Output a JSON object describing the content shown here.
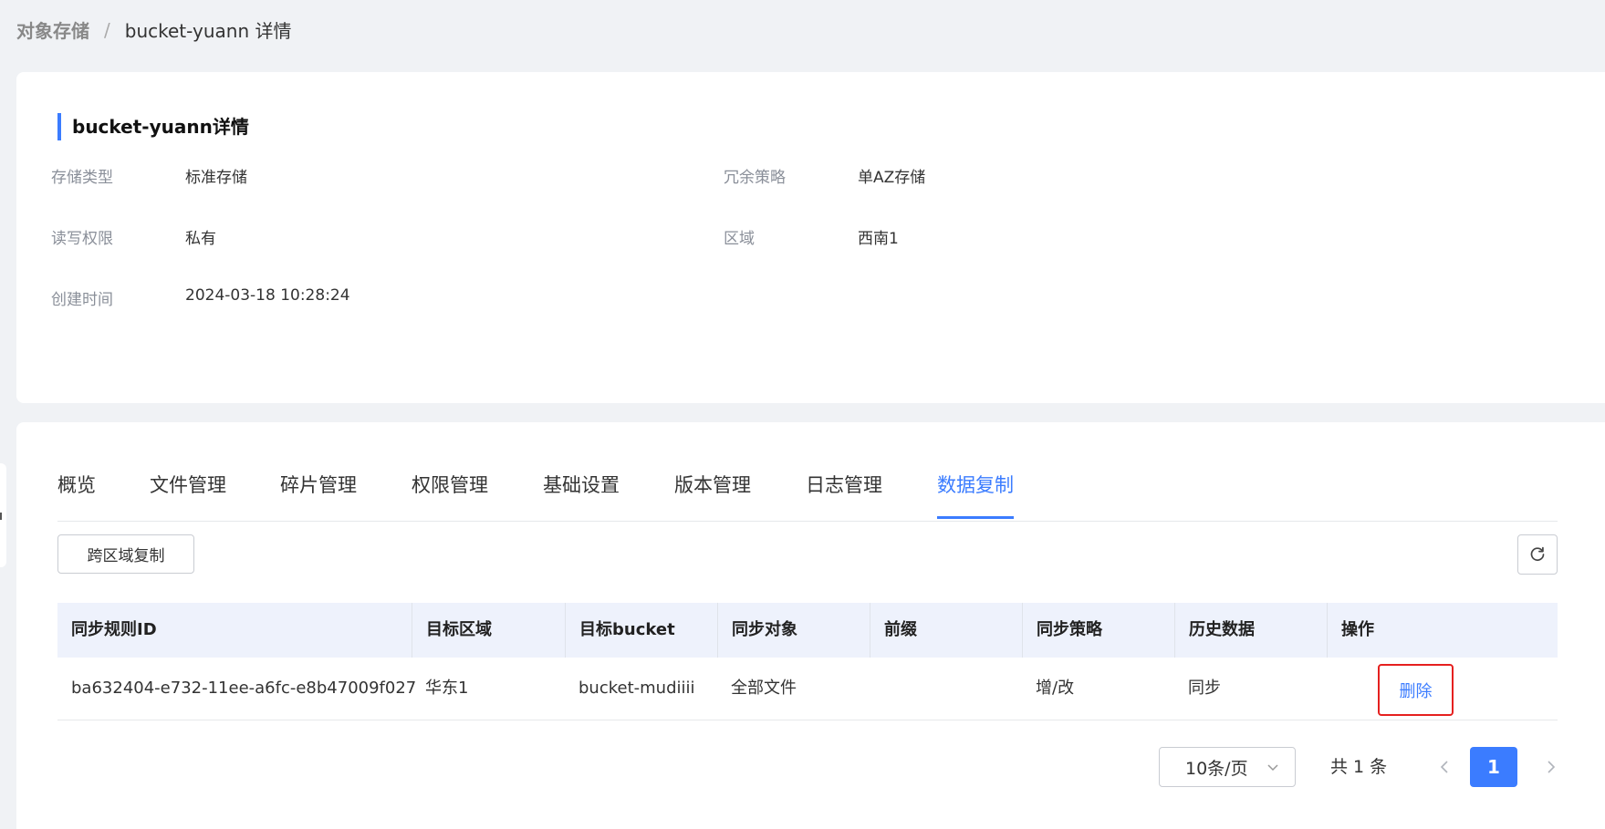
{
  "breadcrumb": {
    "parent": "对象存储",
    "separator": "/",
    "current": "bucket-yuann 详情"
  },
  "detail": {
    "title": "bucket-yuann详情",
    "fields": {
      "storage_type": {
        "label": "存储类型",
        "value": "标准存储"
      },
      "redundancy": {
        "label": "冗余策略",
        "value": "单AZ存储"
      },
      "acl": {
        "label": "读写权限",
        "value": "私有"
      },
      "region": {
        "label": "区域",
        "value": "西南1"
      },
      "created": {
        "label": "创建时间",
        "value": "2024-03-18 10:28:24"
      }
    }
  },
  "tabs": [
    {
      "label": "概览"
    },
    {
      "label": "文件管理"
    },
    {
      "label": "碎片管理"
    },
    {
      "label": "权限管理"
    },
    {
      "label": "基础设置"
    },
    {
      "label": "版本管理"
    },
    {
      "label": "日志管理"
    },
    {
      "label": "数据复制",
      "active": true
    }
  ],
  "toolbar": {
    "cross_region_label": "跨区域复制",
    "refresh_icon": "refresh-icon"
  },
  "table": {
    "columns": [
      "同步规则ID",
      "目标区域",
      "目标bucket",
      "同步对象",
      "前缀",
      "同步策略",
      "历史数据",
      "操作"
    ],
    "rows": [
      {
        "rule_id": "ba632404-e732-11ee-a6fc-e8b47009f027",
        "target_region": "华东1",
        "target_bucket": "bucket-mudiiii",
        "sync_object": "全部文件",
        "prefix": "",
        "sync_policy": "增/改",
        "history": "同步",
        "action": "删除"
      }
    ]
  },
  "pagination": {
    "page_size": "10条/页",
    "total": "共 1 条",
    "current_page": "1"
  },
  "colors": {
    "accent": "#3b7cff",
    "highlight_border": "#e5201f"
  }
}
